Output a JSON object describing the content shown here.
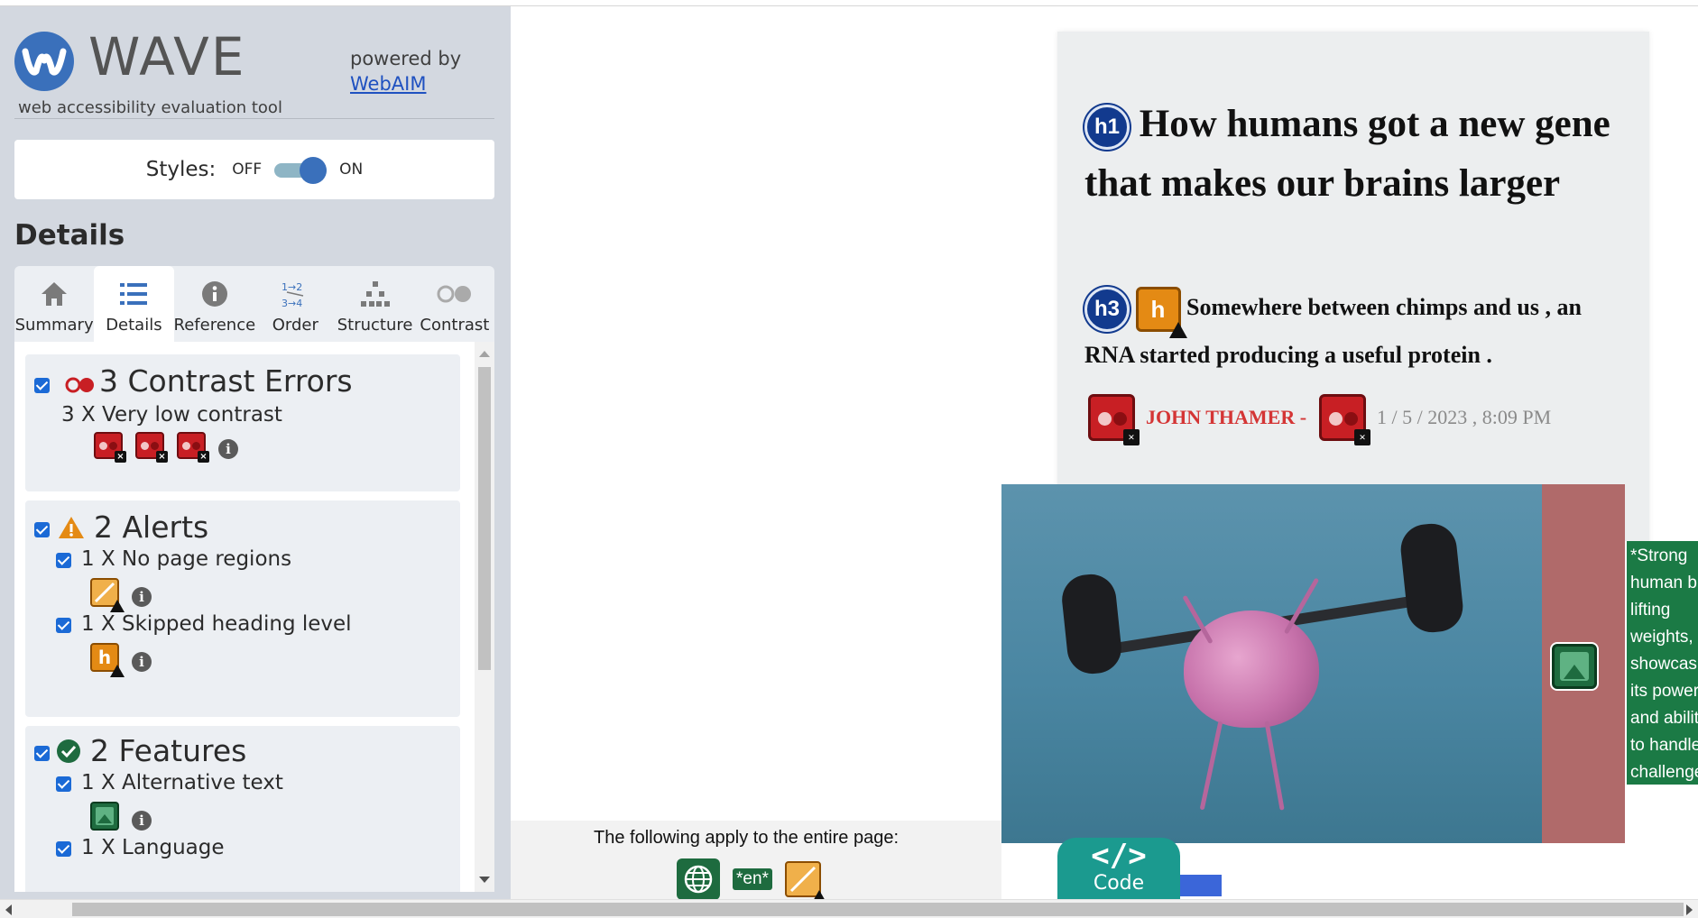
{
  "brand": {
    "name": "WAVE",
    "tagline": "web accessibility evaluation tool",
    "powered_by": "powered by",
    "webaim_link": "WebAIM"
  },
  "styles_toggle": {
    "label": "Styles:",
    "off": "OFF",
    "on": "ON",
    "state": "on"
  },
  "details_heading": "Details",
  "tabs": [
    {
      "label": "Summary",
      "icon": "home-icon"
    },
    {
      "label": "Details",
      "icon": "list-icon",
      "active": true
    },
    {
      "label": "Reference",
      "icon": "info-icon"
    },
    {
      "label": "Order",
      "icon": "order-icon"
    },
    {
      "label": "Structure",
      "icon": "structure-icon"
    },
    {
      "label": "Contrast",
      "icon": "contrast-icon"
    }
  ],
  "categories": {
    "contrast": {
      "title": "3 Contrast Errors",
      "items": [
        {
          "label": "3 X Very low contrast"
        }
      ]
    },
    "alerts": {
      "title": "2 Alerts",
      "items": [
        {
          "label": "1 X No page regions"
        },
        {
          "label": "1 X Skipped heading level"
        }
      ]
    },
    "features": {
      "title": "2 Features",
      "items": [
        {
          "label": "1 X Alternative text"
        },
        {
          "label": "1 X Language"
        }
      ]
    }
  },
  "article": {
    "h1_badge": "h1",
    "headline": "How humans got a new gene that makes our brains larger",
    "h3_badge": "h3",
    "skip_badge": "h",
    "subheadline": "Somewhere between chimps and us , an RNA started producing a useful protein .",
    "author": "JOHN THAMER -",
    "date": "1 / 5 / 2023 , 8:09 PM",
    "image_alt": "*Strong human brain lifting weights, showcasing its power and ability to handle challenges."
  },
  "page_level": {
    "text": "The following apply to the entire page:",
    "lang_badge": "*en*"
  },
  "code_button": {
    "glyph": "</>",
    "label": "Code"
  },
  "colors": {
    "sidebar_bg": "#d3d8e0",
    "accent_blue": "#3a70bb",
    "error_red": "#c81f24",
    "alert_orange": "#e48a14",
    "feature_green": "#1e6b3f",
    "code_teal": "#1b9a8f"
  }
}
